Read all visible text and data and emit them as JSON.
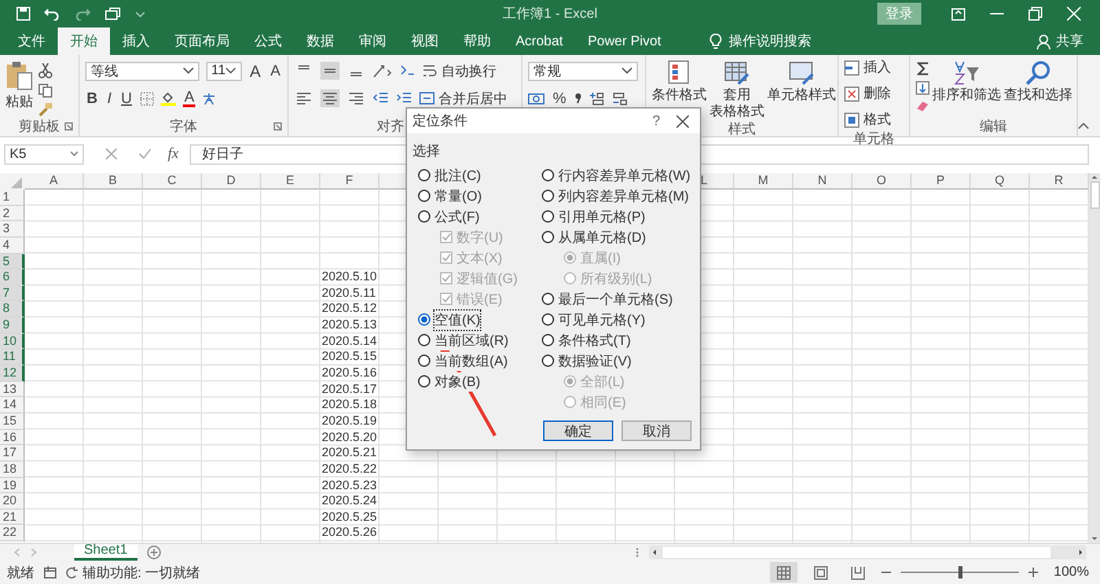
{
  "window": {
    "title": "工作簿1 - Excel",
    "sign_in": "登录"
  },
  "tabs": [
    {
      "label": "文件",
      "selected": false
    },
    {
      "label": "开始",
      "selected": true
    },
    {
      "label": "插入",
      "selected": false
    },
    {
      "label": "页面布局",
      "selected": false
    },
    {
      "label": "公式",
      "selected": false
    },
    {
      "label": "数据",
      "selected": false
    },
    {
      "label": "审阅",
      "selected": false
    },
    {
      "label": "视图",
      "selected": false
    },
    {
      "label": "帮助",
      "selected": false
    },
    {
      "label": "Acrobat",
      "selected": false
    },
    {
      "label": "Power Pivot",
      "selected": false
    }
  ],
  "tell_me": "操作说明搜索",
  "share": "共享",
  "ribbon": {
    "clipboard": {
      "paste": "粘贴",
      "label": "剪贴板"
    },
    "font": {
      "name": "等线",
      "size": "11",
      "grow": "A",
      "shrink": "A",
      "bold": "B",
      "italic": "I",
      "underline": "U",
      "color_letter": "A",
      "label": "字体"
    },
    "alignment": {
      "vertical": [
        {
          "selected": false
        },
        {
          "selected": true
        },
        {
          "selected": false
        }
      ],
      "horizontal": [
        {
          "selected": false
        },
        {
          "selected": true
        },
        {
          "selected": false
        }
      ],
      "wrap": "自动换行",
      "merge": "合并后居中",
      "label": "对齐"
    },
    "number": {
      "format": "常规",
      "percent": "%"
    },
    "styles": {
      "items": [
        {
          "lines": [
            "条件格式"
          ],
          "kind": "conditional"
        },
        {
          "lines": [
            "套用",
            "表格格式"
          ],
          "kind": "table"
        },
        {
          "lines": [
            "单元格样式"
          ],
          "kind": "cell"
        }
      ],
      "label": "样式"
    },
    "cells": {
      "items": [
        {
          "label": "插入",
          "kind": "insert"
        },
        {
          "label": "删除",
          "kind": "delete"
        },
        {
          "label": "格式",
          "kind": "format"
        }
      ],
      "label": "单元格"
    },
    "editing": {
      "sort": "排序和筛选",
      "find": "查找和选择",
      "label": "编辑"
    }
  },
  "formula_bar": {
    "name_box": "K5",
    "fx": "fx",
    "value": "好日子"
  },
  "sheet": {
    "columns_left": [
      "A",
      "B",
      "C",
      "D",
      "E",
      "F"
    ],
    "columns_right": [
      "L",
      "M",
      "N",
      "O",
      "P",
      "Q",
      "R"
    ],
    "rows": [
      {
        "number": "1",
        "selected": false
      },
      {
        "number": "2",
        "selected": false
      },
      {
        "number": "3",
        "selected": false
      },
      {
        "number": "4",
        "selected": false
      },
      {
        "number": "5",
        "selected": true
      },
      {
        "number": "6",
        "selected": true,
        "f": "2020.5.10"
      },
      {
        "number": "7",
        "selected": true,
        "f": "2020.5.11"
      },
      {
        "number": "8",
        "selected": true,
        "f": "2020.5.12"
      },
      {
        "number": "9",
        "selected": true,
        "f": "2020.5.13"
      },
      {
        "number": "10",
        "selected": true,
        "f": "2020.5.14"
      },
      {
        "number": "11",
        "selected": true,
        "f": "2020.5.15"
      },
      {
        "number": "12",
        "selected": true,
        "f": "2020.5.16"
      },
      {
        "number": "13",
        "selected": false,
        "f": "2020.5.17"
      },
      {
        "number": "14",
        "selected": false,
        "f": "2020.5.18"
      },
      {
        "number": "15",
        "selected": false,
        "f": "2020.5.19"
      },
      {
        "number": "16",
        "selected": false,
        "f": "2020.5.20"
      },
      {
        "number": "17",
        "selected": false,
        "f": "2020.5.21"
      },
      {
        "number": "18",
        "selected": false,
        "f": "2020.5.22"
      },
      {
        "number": "19",
        "selected": false,
        "f": "2020.5.23"
      },
      {
        "number": "20",
        "selected": false,
        "f": "2020.5.24"
      },
      {
        "number": "21",
        "selected": false,
        "f": "2020.5.25"
      },
      {
        "number": "22",
        "selected": false,
        "f": "2020.5.26"
      }
    ]
  },
  "sheet_tabs": [
    {
      "label": "Sheet1",
      "selected": true
    }
  ],
  "status_bar": {
    "ready": "就绪",
    "accessibility": "辅助功能: 一切就绪",
    "views": [
      {
        "kind": "normal",
        "selected": true
      },
      {
        "kind": "layout",
        "selected": false
      },
      {
        "kind": "break",
        "selected": false
      }
    ],
    "zoom_slider": {
      "level": 0.5
    },
    "zoom": "100%"
  },
  "dialog": {
    "title": "定位条件",
    "help": "?",
    "section": "选择",
    "left": [
      {
        "kind": "radio",
        "label": "批注(C)",
        "selected": false
      },
      {
        "kind": "radio",
        "label": "常量(O)",
        "selected": false
      },
      {
        "kind": "radio",
        "label": "公式(F)",
        "selected": false,
        "children": [
          {
            "kind": "checkbox",
            "label": "数字(U)",
            "checked": true,
            "disabled": true
          },
          {
            "kind": "checkbox",
            "label": "文本(X)",
            "checked": true,
            "disabled": true
          },
          {
            "kind": "checkbox",
            "label": "逻辑值(G)",
            "checked": true,
            "disabled": true
          },
          {
            "kind": "checkbox",
            "label": "错误(E)",
            "checked": true,
            "disabled": true
          }
        ]
      },
      {
        "kind": "radio",
        "label": "空值(K)",
        "selected": true
      },
      {
        "kind": "radio",
        "label": "当前区域(R)",
        "selected": false
      },
      {
        "kind": "radio",
        "label": "当前数组(A)",
        "selected": false
      },
      {
        "kind": "radio",
        "label": "对象(B)",
        "selected": false
      }
    ],
    "right": [
      {
        "kind": "radio",
        "label": "行内容差异单元格(W)",
        "selected": false
      },
      {
        "kind": "radio",
        "label": "列内容差异单元格(M)",
        "selected": false
      },
      {
        "kind": "radio",
        "label": "引用单元格(P)",
        "selected": false
      },
      {
        "kind": "radio",
        "label": "从属单元格(D)",
        "selected": false,
        "children": [
          {
            "kind": "radio",
            "label": "直属(I)",
            "selected": true,
            "disabled": true
          },
          {
            "kind": "radio",
            "label": "所有级别(L)",
            "selected": false,
            "disabled": true
          }
        ]
      },
      {
        "kind": "radio",
        "label": "最后一个单元格(S)",
        "selected": false
      },
      {
        "kind": "radio",
        "label": "可见单元格(Y)",
        "selected": false
      },
      {
        "kind": "radio",
        "label": "条件格式(T)",
        "selected": false
      },
      {
        "kind": "radio",
        "label": "数据验证(V)",
        "selected": false,
        "children": [
          {
            "kind": "radio",
            "label": "全部(L)",
            "selected": true,
            "disabled": true
          },
          {
            "kind": "radio",
            "label": "相同(E)",
            "selected": false,
            "disabled": true
          }
        ]
      }
    ],
    "buttons": [
      "确定",
      "取消"
    ]
  }
}
